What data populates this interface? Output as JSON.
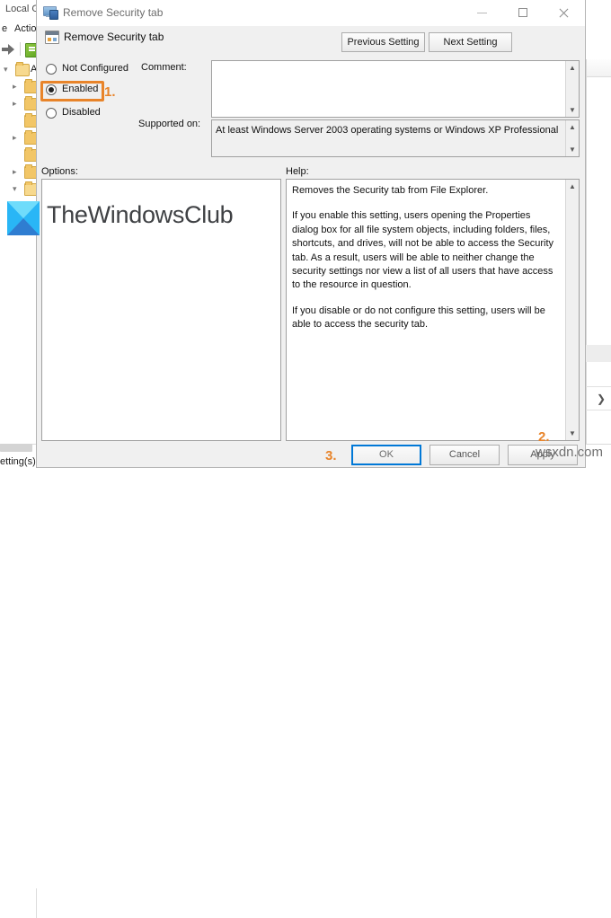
{
  "background": {
    "title": "Local Gr",
    "menus": [
      "e",
      "Actio"
    ],
    "toolbar_icons": [
      "right-arrow-icon",
      "new-policy-icon"
    ],
    "tree": [
      {
        "label": "A",
        "chevron": "v",
        "indent": 0
      },
      {
        "label": "",
        "chevron": ">",
        "indent": 1
      },
      {
        "label": "",
        "chevron": ">",
        "indent": 1
      },
      {
        "label": "",
        "chevron": "",
        "indent": 1
      },
      {
        "label": "",
        "chevron": ">",
        "indent": 1
      },
      {
        "label": "",
        "chevron": ">",
        "indent": 1
      },
      {
        "label": "",
        "chevron": "v",
        "indent": 1
      }
    ],
    "status_text": "etting(s)"
  },
  "dialog": {
    "titlebar": {
      "icon": "policy-setting-icon",
      "title": "Remove Security tab",
      "minimize_label": "Minimize",
      "maximize_label": "Maximize",
      "close_label": "Close"
    },
    "header": {
      "icon": "policy-document-icon",
      "title": "Remove Security tab",
      "previous_button": "Previous Setting",
      "next_button": "Next Setting"
    },
    "state_options": [
      {
        "label": "Not Configured",
        "selected": false
      },
      {
        "label": "Enabled",
        "selected": true
      },
      {
        "label": "Disabled",
        "selected": false
      }
    ],
    "comment_label": "Comment:",
    "comment_value": "",
    "supported_on_label": "Supported on:",
    "supported_on_value": "At least Windows Server 2003 operating systems or Windows XP Professional",
    "options_label": "Options:",
    "help_label": "Help:",
    "help_paragraphs": [
      "Removes the Security tab from File Explorer.",
      "If you enable this setting, users opening the Properties dialog box for all file system objects, including folders, files, shortcuts, and drives, will not be able to access the Security tab. As a result, users will be able to neither change the security settings nor view a list of all users that have access to the resource in question.",
      "If you disable or do not configure this setting, users will be able to access the security tab."
    ],
    "buttons": {
      "ok": "OK",
      "cancel": "Cancel",
      "apply": "Apply"
    }
  },
  "annotations": {
    "step1": "1.",
    "step2": "2.",
    "step3": "3.",
    "color": "#e8842a"
  },
  "watermarks": {
    "brand": "TheWindowsClub",
    "site": "wsxdn.com"
  }
}
